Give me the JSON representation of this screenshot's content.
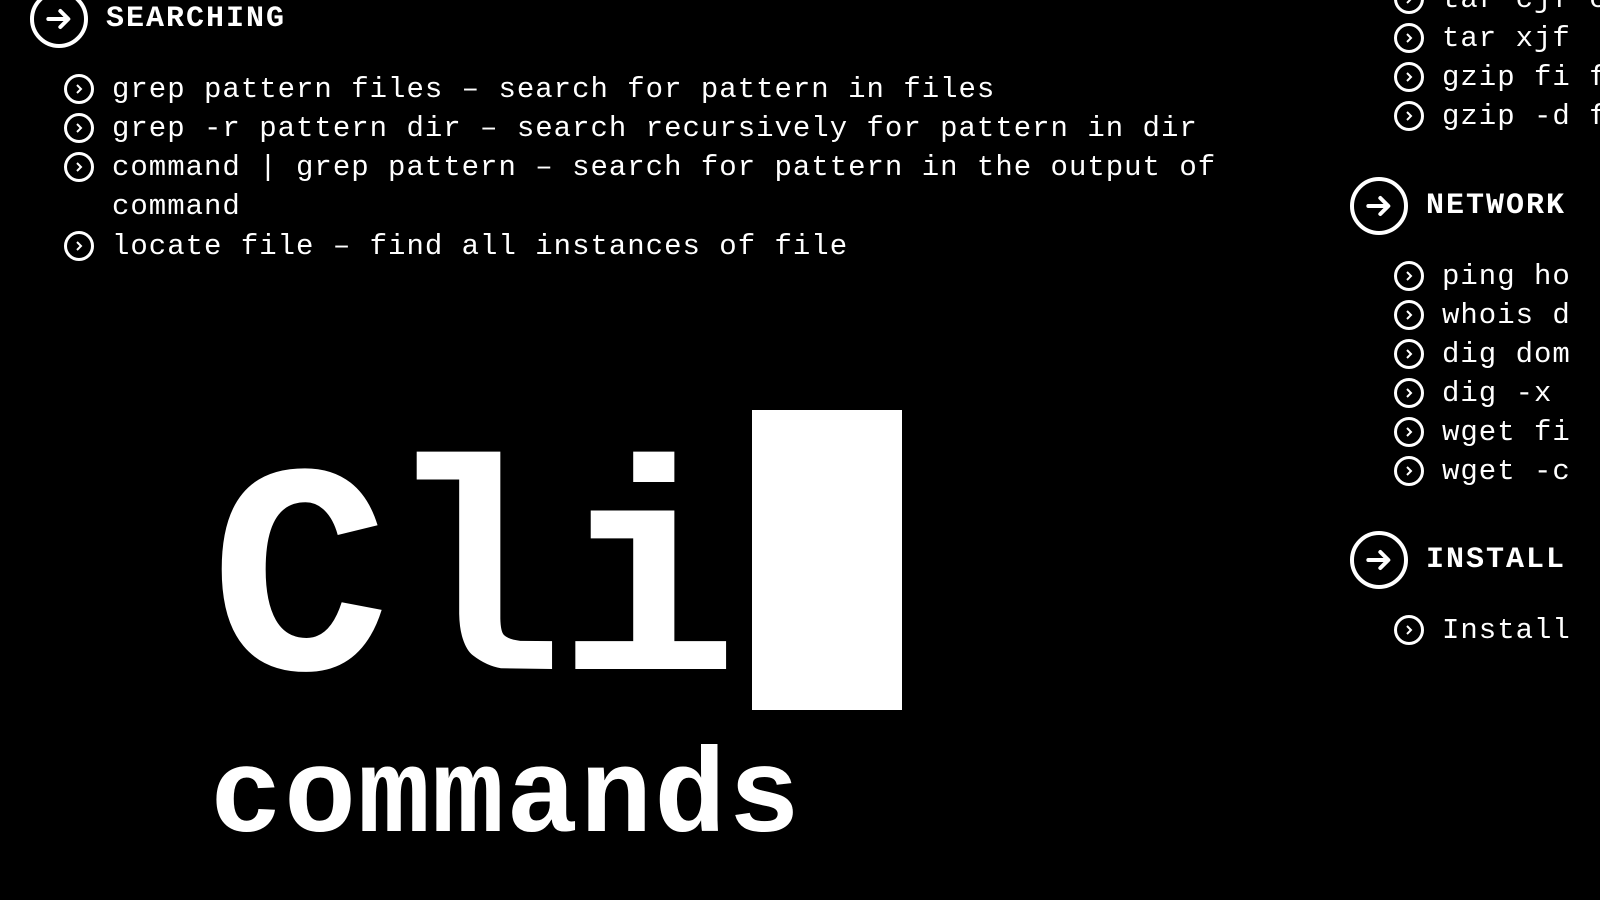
{
  "left": {
    "searching": {
      "title": "SEARCHING",
      "items": [
        "grep pattern files – search for pattern in files",
        "grep -r pattern dir – search recursively for pattern in dir",
        "command | grep pattern – search for pattern in the output of command",
        "locate file – find all instances of file"
      ]
    }
  },
  "logo": {
    "main": "Cli",
    "sub": "commands"
  },
  "right": {
    "compression_tail": {
      "items": [
        "tar cjf compres",
        "tar xjf",
        "gzip fi file.gz",
        "gzip -d file"
      ]
    },
    "networking": {
      "title": "NETWORK",
      "items": [
        "ping ho",
        "whois d",
        "dig dom",
        "dig -x ",
        "wget fi",
        "wget -c"
      ]
    },
    "installation": {
      "title": "INSTALL",
      "items": [
        "Install"
      ]
    }
  }
}
